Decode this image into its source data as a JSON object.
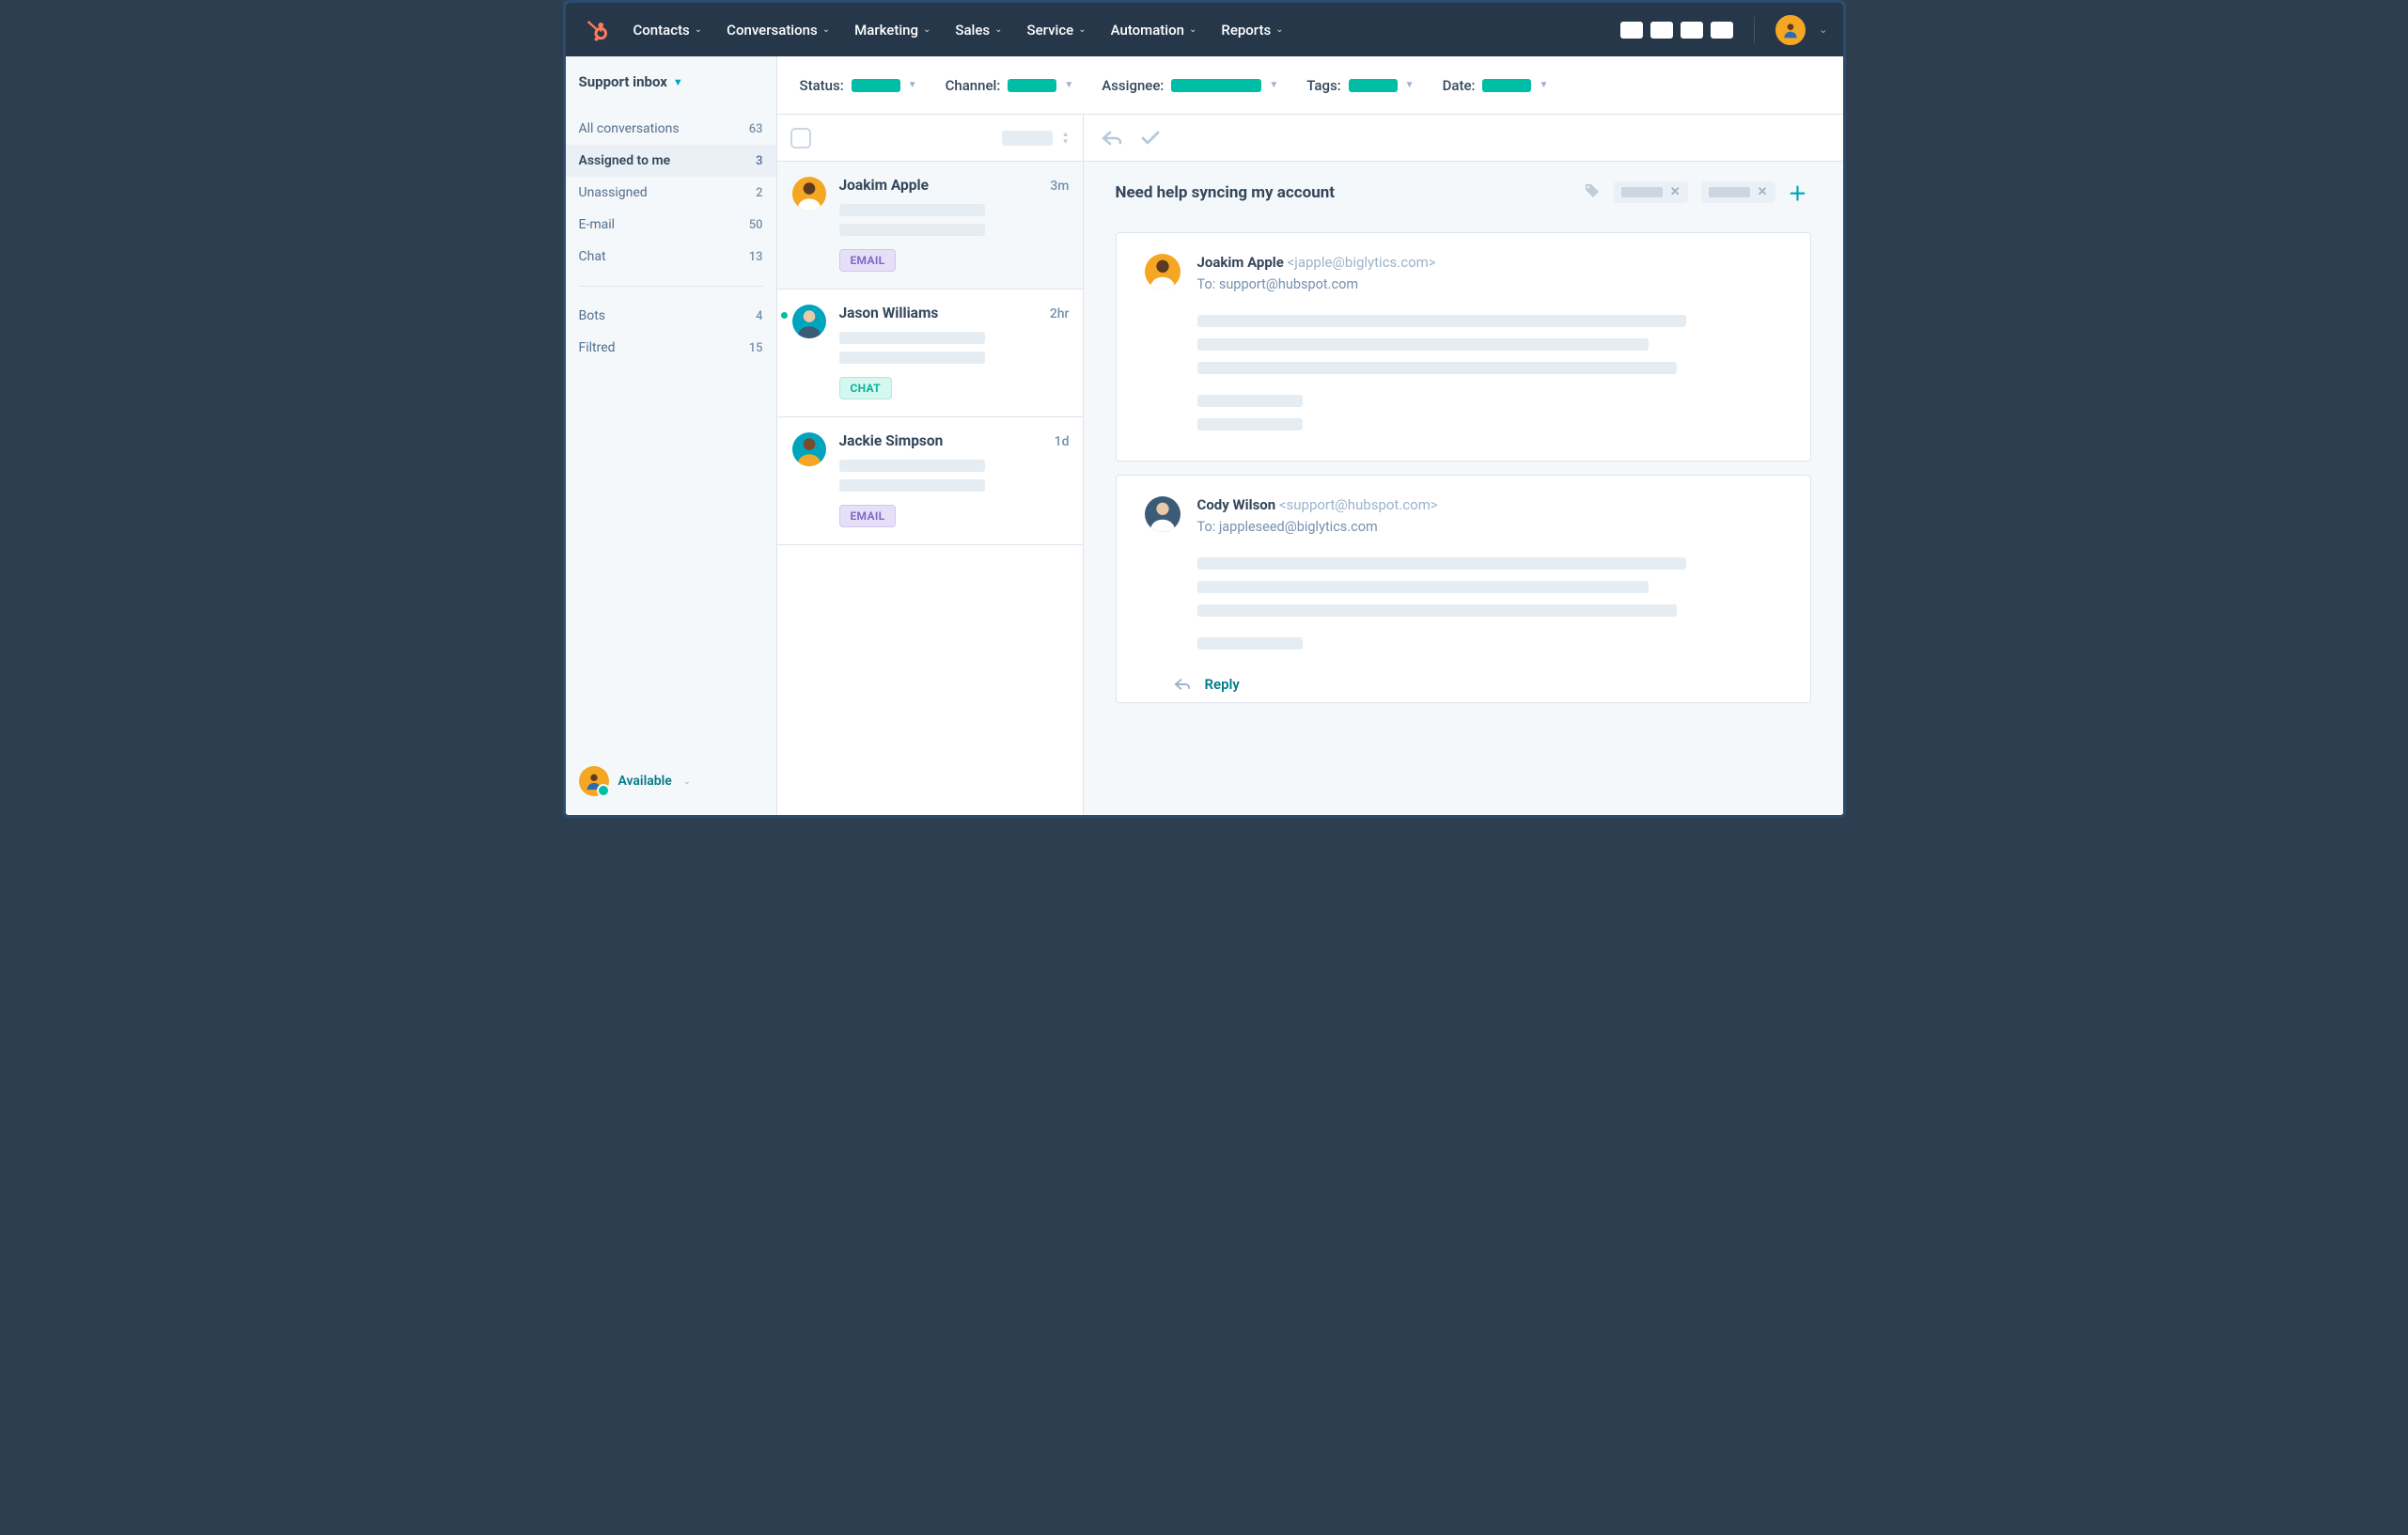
{
  "nav": {
    "items": [
      "Contacts",
      "Conversations",
      "Marketing",
      "Sales",
      "Service",
      "Automation",
      "Reports"
    ]
  },
  "sidebar": {
    "title": "Support inbox",
    "items": [
      {
        "label": "All conversations",
        "count": "63"
      },
      {
        "label": "Assigned to me",
        "count": "3"
      },
      {
        "label": "Unassigned",
        "count": "2"
      },
      {
        "label": "E-mail",
        "count": "50"
      },
      {
        "label": "Chat",
        "count": "13"
      }
    ],
    "items2": [
      {
        "label": "Bots",
        "count": "4"
      },
      {
        "label": "Filtred",
        "count": "15"
      }
    ],
    "status": "Available"
  },
  "filters": {
    "status": "Status:",
    "channel": "Channel:",
    "assignee": "Assignee:",
    "tags": "Tags:",
    "date": "Date:"
  },
  "conversations": [
    {
      "name": "Joakim Apple",
      "time": "3m",
      "tag": "EMAIL",
      "tagType": "email",
      "avatar": "ja"
    },
    {
      "name": "Jason Williams",
      "time": "2hr",
      "tag": "CHAT",
      "tagType": "chat",
      "avatar": "jw",
      "unread": true
    },
    {
      "name": "Jackie Simpson",
      "time": "1d",
      "tag": "EMAIL",
      "tagType": "email",
      "avatar": "js"
    }
  ],
  "detail": {
    "subject": "Need help syncing my account",
    "messages": [
      {
        "name": "Joakim Apple",
        "email": "<japple@biglytics.com>",
        "to": "To: support@hubspot.com",
        "avatar": "ja"
      },
      {
        "name": "Cody Wilson",
        "email": "<support@hubspot.com>",
        "to": "To: jappleseed@biglytics.com",
        "avatar": "cw"
      }
    ],
    "reply": "Reply"
  }
}
